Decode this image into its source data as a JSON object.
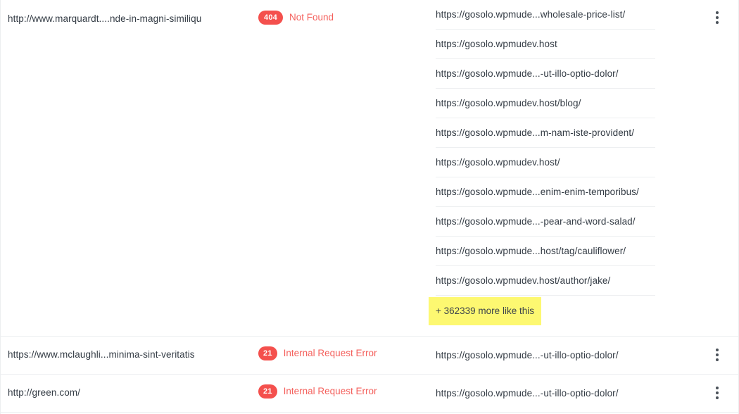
{
  "table": {
    "rows": [
      {
        "source_url": "http://www.marquardt....nde-in-magni-similiqu",
        "status_code": "404",
        "status_label": "Not Found",
        "menu_icon": "kebab-menu-icon",
        "urls": [
          "https://gosolo.wpmude...wholesale-price-list/",
          "https://gosolo.wpmudev.host",
          "https://gosolo.wpmude...-ut-illo-optio-dolor/",
          "https://gosolo.wpmudev.host/blog/",
          "https://gosolo.wpmude...m-nam-iste-provident/",
          "https://gosolo.wpmudev.host/",
          "https://gosolo.wpmude...enim-enim-temporibus/",
          "https://gosolo.wpmude...-pear-and-word-salad/",
          "https://gosolo.wpmude...host/tag/cauliflower/",
          "https://gosolo.wpmudev.host/author/jake/"
        ],
        "more_label": "+ 362339 more like this",
        "more_count": "362339",
        "more_highlight_color": "#fdf871"
      },
      {
        "source_url": "https://www.mclaughli...minima-sint-veritatis",
        "status_code": "21",
        "status_label": "Internal Request Error",
        "menu_icon": "kebab-menu-icon",
        "urls": [
          "https://gosolo.wpmude...-ut-illo-optio-dolor/"
        ]
      },
      {
        "source_url": "http://green.com/",
        "status_code": "21",
        "status_label": "Internal Request Error",
        "menu_icon": "kebab-menu-icon",
        "urls": [
          "https://gosolo.wpmude...-ut-illo-optio-dolor/"
        ]
      }
    ]
  },
  "theme": {
    "badge_bg": "#f4504d",
    "status_text": "#f4605c",
    "text": "#333b44",
    "divider": "#eceef0",
    "highlight": "#fdf871"
  }
}
